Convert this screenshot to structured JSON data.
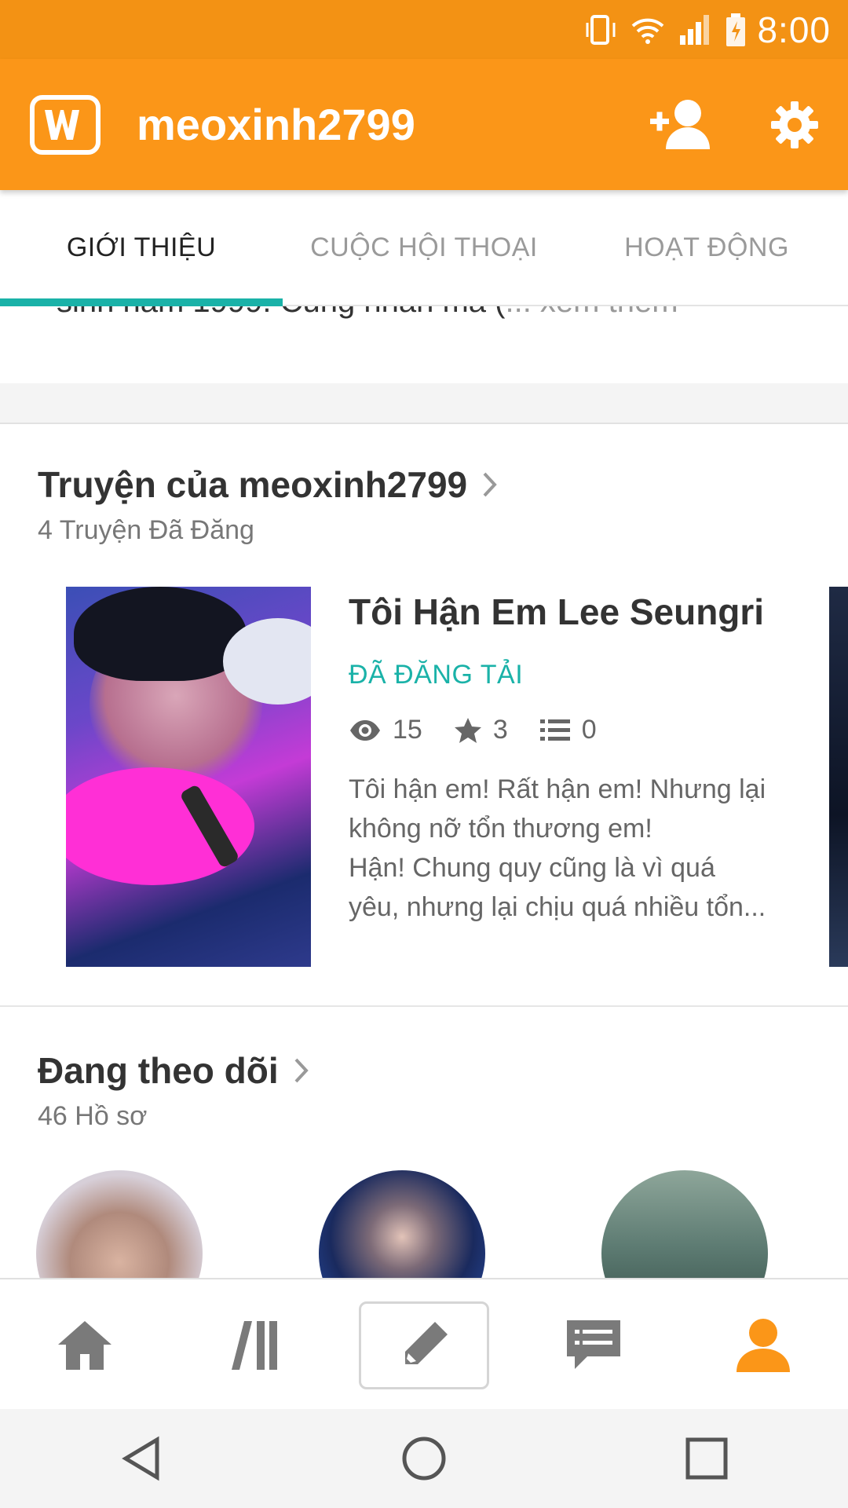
{
  "status_bar": {
    "time": "8:00"
  },
  "app_bar": {
    "username": "meoxinh2799",
    "logo_icon": "wattpad-w-icon",
    "add_user_icon": "add-person-icon",
    "settings_icon": "gear-icon"
  },
  "tabs": [
    {
      "label": "GIỚI THIỆU",
      "active": true
    },
    {
      "label": "CUỘC HỘI THOẠI",
      "active": false
    },
    {
      "label": "HOẠT ĐỘNG",
      "active": false
    }
  ],
  "bio": {
    "text": "sinh năm 1999. Cung nhân mã (",
    "more": "... xem thêm"
  },
  "stories_section": {
    "title": "Truyện của meoxinh2799",
    "subtitle": "4 Truyện Đã Đăng",
    "story": {
      "title": "Tôi Hận Em Lee Seungri",
      "status": "ĐÃ ĐĂNG TẢI",
      "views": "15",
      "votes": "3",
      "parts": "0",
      "description": [
        "Tôi hận em! Rất hận em! Nhưng lại",
        "không nỡ tổn thương em!",
        "Hận! Chung quy cũng là vì quá",
        "yêu, nhưng lại chịu quá nhiều tổn..."
      ]
    }
  },
  "following_section": {
    "title": "Đang theo dõi",
    "subtitle": "46 Hồ sơ"
  },
  "bottom_nav": [
    "home-icon",
    "library-icon",
    "write-icon",
    "messages-icon",
    "profile-icon"
  ],
  "colors": {
    "brand_orange": "#fb9618",
    "accent_teal": "#1ab2a8"
  }
}
